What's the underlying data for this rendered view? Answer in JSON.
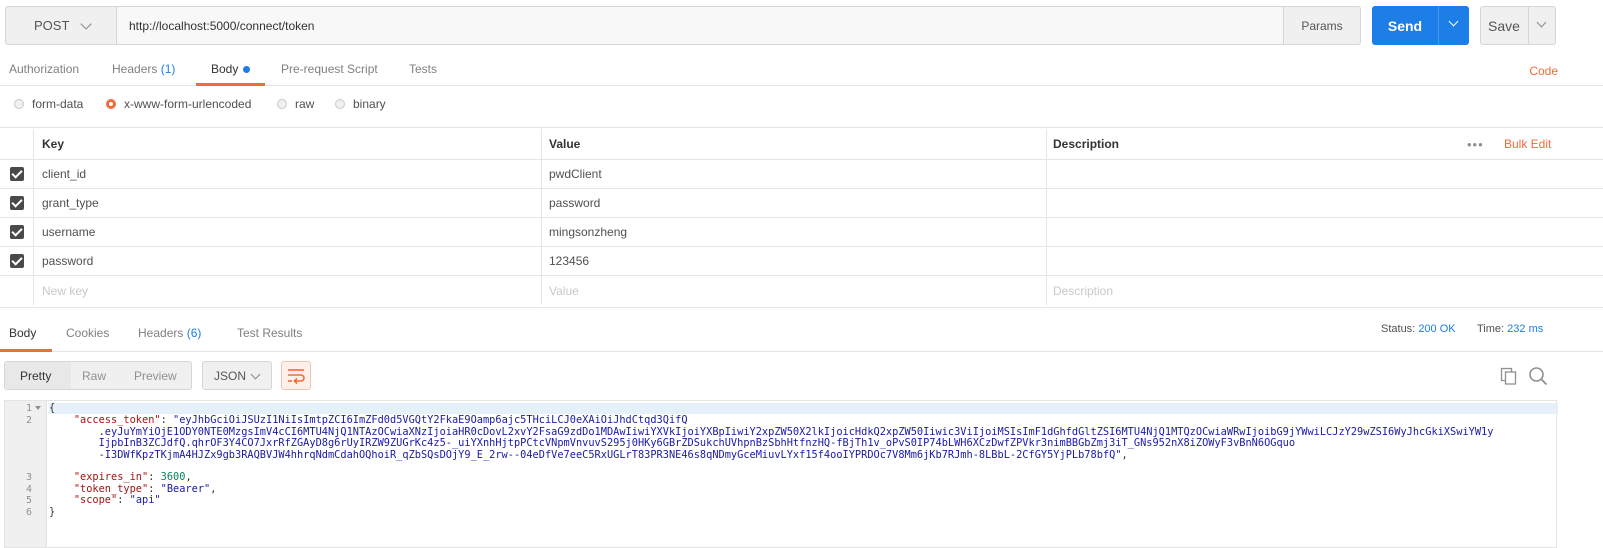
{
  "request": {
    "method": "POST",
    "url": "http://localhost:5000/connect/token",
    "params_label": "Params",
    "send_label": "Send",
    "save_label": "Save"
  },
  "request_tabs": {
    "authorization": "Authorization",
    "headers": "Headers",
    "headers_count": "(1)",
    "body": "Body",
    "prerequest": "Pre-request Script",
    "tests": "Tests",
    "code": "Code"
  },
  "body_types": {
    "form_data": "form-data",
    "urlencoded": "x-www-form-urlencoded",
    "raw": "raw",
    "binary": "binary",
    "selected": "x-www-form-urlencoded"
  },
  "kv_table": {
    "headers": {
      "key": "Key",
      "value": "Value",
      "description": "Description"
    },
    "more": "•••",
    "bulk_edit": "Bulk Edit",
    "rows": [
      {
        "key": "client_id",
        "value": "pwdClient",
        "description": "",
        "checked": true
      },
      {
        "key": "grant_type",
        "value": "password",
        "description": "",
        "checked": true
      },
      {
        "key": "username",
        "value": "mingsonzheng",
        "description": "",
        "checked": true
      },
      {
        "key": "password",
        "value": "123456",
        "description": "",
        "checked": true
      }
    ],
    "placeholders": {
      "key": "New key",
      "value": "Value",
      "description": "Description"
    }
  },
  "response_tabs": {
    "body": "Body",
    "cookies": "Cookies",
    "headers": "Headers",
    "headers_count": "(6)",
    "test_results": "Test Results",
    "status_label": "Status:",
    "status_value": "200 OK",
    "time_label": "Time:",
    "time_value": "232 ms"
  },
  "response_toolbar": {
    "pretty": "Pretty",
    "raw": "Raw",
    "preview": "Preview",
    "format": "JSON",
    "icons": [
      "wrap-lines-icon",
      "copy-icon",
      "search-icon"
    ],
    "accent": "#f26b3a"
  },
  "response_body": {
    "line_numbers": [
      "1",
      "2",
      "",
      "",
      "",
      "3",
      "4",
      "5",
      "6"
    ],
    "open": "{",
    "access_token_key": "\"access_token\"",
    "access_token_l1": "\"eyJhbGciOiJSUzI1NiIsImtpZCI6ImZFd0d5VGQtY2FkaE9Oamp6ajc5THciLCJ0eXAiOiJhdCtqd3QifQ",
    "access_token_l2": ".eyJuYmYiOjE1ODY0NTE0MzgsImV4cCI6MTU4NjQ1NTAzOCwiaXNzIjoiaHR0cDovL2xvY2FsaG9zdDo1MDAwIiwiYXVkIjoiYXBpIiwiY2xpZW50X2lkIjoicHdkQ2xpZW50Iiwic3ViIjoiMSIsImF1dGhfdGltZSI6MTU4NjQ1MTQzOCwiaWRwIjoibG9jYWwiLCJzY29wZSI6WyJhcGkiXSwiYW1y",
    "access_token_l3": "IjpbInB3ZCJdfQ.qhrOF3Y4CO7JxrRfZGAyD8g6rUyIRZW9ZUGrKc4z5-_uiYXnhHjtpPCtcVNpmVnvuvS295j0HKy6GBrZDSukchUVhpnBzSbhHtfnzHQ-fBjTh1v_oPvS0IP74bLWH6XCzDwfZPVkr3nimBBGbZmj3iT_GNs952nX8iZOWyF3vBnN6OGquo",
    "access_token_l4": "-I3DWfKpzTKjmA4HJZx9gb3RAQBVJW4hhrqNdmCdahOQhoiR_qZbSQsDOjY9_E_2rw--04eDfVe7eeC5RxUGLrT83PR3NE46s8qNDmyGceMiuvLYxf15f4ooIYPRDOc7V8Mm6jKb7RJmh-8LBbL-2CfGY5YjPLb78bfQ\"",
    "expires_in_key": "\"expires_in\"",
    "expires_in_value": "3600",
    "token_type_key": "\"token_type\"",
    "token_type_value": "\"Bearer\"",
    "scope_key": "\"scope\"",
    "scope_value": "\"api\"",
    "close": "}"
  }
}
